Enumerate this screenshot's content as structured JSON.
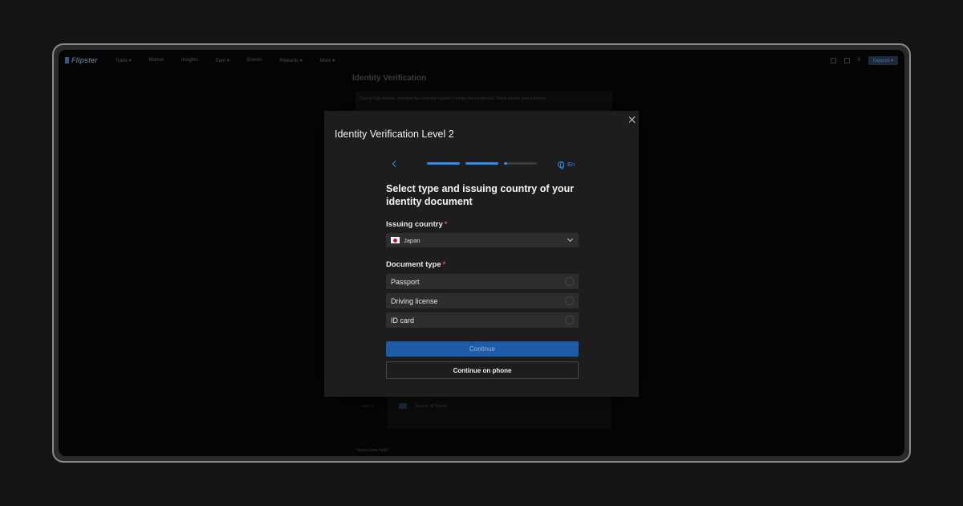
{
  "background_app": {
    "brand": "Flipster",
    "nav": [
      "Trade ▾",
      "Market",
      "Insights",
      "Earn ▾",
      "Events",
      "Rewards ▾",
      "More ▾"
    ],
    "nav_right_badge": "0",
    "nav_right_button": "Deposit ▾",
    "page_title": "Identity Verification",
    "notice_text": "Due to high volume, wait time for customer support is longer than expected. Thank you for your patience.",
    "card_label": "Source of Funds",
    "side_label": "Level 4",
    "footer_text": "Need some help?"
  },
  "modal": {
    "title": "Identity Verification Level 2",
    "language": "En",
    "progress": [
      1.0,
      1.0,
      0.1
    ],
    "heading": "Select type and issuing country of your identity document",
    "issuing_country": {
      "label": "Issuing country",
      "required_mark": "*",
      "value": "Japan"
    },
    "document_type": {
      "label": "Document type",
      "required_mark": "*",
      "options": [
        "Passport",
        "Driving license",
        "ID card"
      ]
    },
    "continue_label": "Continue",
    "continue_phone_label": "Continue on phone"
  },
  "colors": {
    "accent": "#2f8cf0",
    "primary_button": "#1d5aa8",
    "required": "#e5484d"
  }
}
